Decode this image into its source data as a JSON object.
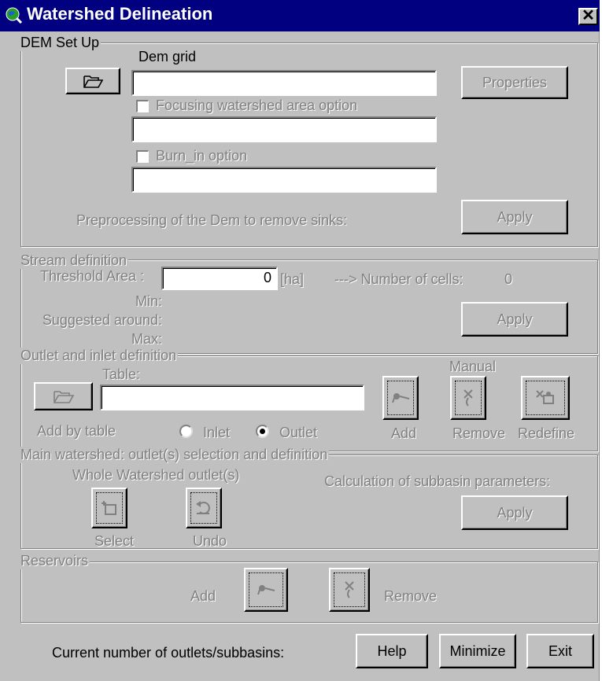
{
  "window": {
    "title": "Watershed Delineation",
    "close_label": "✕"
  },
  "dem_setup": {
    "legend": "DEM Set Up",
    "dem_grid_label": "Dem grid",
    "dem_grid_value": "",
    "properties_label": "Properties",
    "focusing_label": "Focusing watershed  area option",
    "focusing_checked": false,
    "focusing_value": "",
    "burn_in_label": "Burn_in option",
    "burn_in_checked": false,
    "burn_in_value": "",
    "preprocess_label": "Preprocessing of the Dem to remove sinks:",
    "apply_label": "Apply"
  },
  "stream": {
    "legend": "Stream definition",
    "threshold_label": "Threshold Area :",
    "threshold_value": "0",
    "unit": "[ha]",
    "cells_label": "---> Number of cells:",
    "cells_value": "0",
    "min_label": "Min:",
    "suggested_label": "Suggested around:",
    "max_label": "Max:",
    "apply_label": "Apply"
  },
  "outlet": {
    "legend": "Outlet  and inlet definition",
    "table_label": "Table:",
    "table_value": "",
    "manual_label": "Manual",
    "add_by_table_label": "Add by table",
    "inlet_label": "Inlet",
    "outlet_label": "Outlet",
    "selected": "outlet",
    "add_label": "Add",
    "remove_label": "Remove",
    "redefine_label": "Redefine"
  },
  "main_watershed": {
    "legend": "Main watershed: outlet(s) selection and definition",
    "whole_label": "Whole Watershed outlet(s)",
    "calc_label": "Calculation of subbasin parameters:",
    "select_label": "Select",
    "undo_label": "Undo",
    "apply_label": "Apply"
  },
  "reservoirs": {
    "legend": "Reservoirs",
    "add_label": "Add",
    "remove_label": "Remove"
  },
  "footer": {
    "current_label": "Current number of outlets/subbasins:",
    "help_label": "Help",
    "minimize_label": "Minimize",
    "exit_label": "Exit"
  },
  "icons": {
    "app": "globe-magnifier-icon",
    "open_folder": "folder-open-icon",
    "add_point": "add-point-icon",
    "remove_point": "remove-point-icon",
    "redefine_point": "redefine-point-icon",
    "select": "select-outlet-icon",
    "undo": "undo-icon"
  },
  "colors": {
    "title_bar": "#000080",
    "face": "#c0c0c0",
    "disabled_text": "#808080"
  }
}
